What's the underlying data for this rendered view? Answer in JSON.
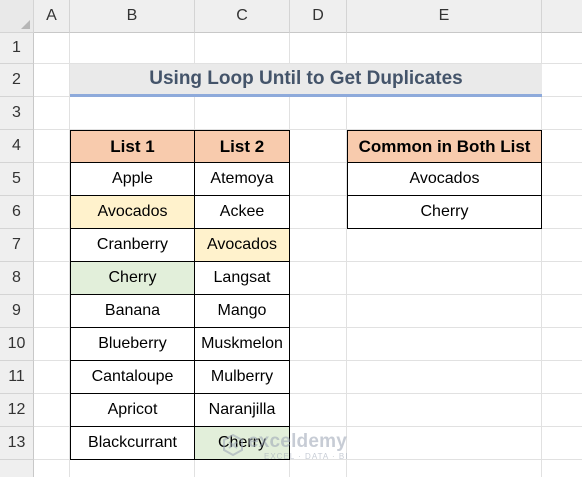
{
  "columns": [
    "A",
    "B",
    "C",
    "D",
    "E"
  ],
  "rows": [
    "1",
    "2",
    "3",
    "4",
    "5",
    "6",
    "7",
    "8",
    "9",
    "10",
    "11",
    "12",
    "13"
  ],
  "title": "Using Loop Until to Get Duplicates",
  "list_table": {
    "headers": [
      "List 1",
      "List 2"
    ],
    "list1": [
      "Apple",
      "Avocados",
      "Cranberry",
      "Cherry",
      "Banana",
      "Blueberry",
      "Cantaloupe",
      "Apricot",
      "Blackcurrant"
    ],
    "list2": [
      "Atemoya",
      "Ackee",
      "Avocados",
      "Langsat",
      "Mango",
      "Muskmelon",
      "Mulberry",
      "Naranjilla",
      "Cherry"
    ]
  },
  "common_table": {
    "header": "Common in Both List",
    "values": [
      "Avocados",
      "Cherry"
    ]
  },
  "watermark": {
    "name": "exceldemy",
    "tagline": "EXCEL · DATA · BI"
  },
  "colors": {
    "header_fill": "#f8cbad",
    "highlight_yellow": "#fff2cc",
    "highlight_green": "#e2efda",
    "title_fill": "#eaeaea",
    "title_text": "#44546a",
    "title_underline": "#8eaadb"
  }
}
